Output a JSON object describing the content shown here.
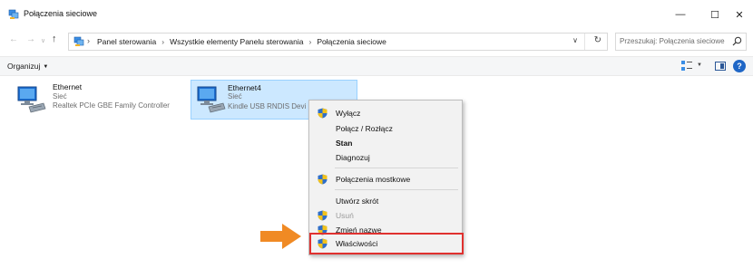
{
  "window": {
    "title": "Połączenia sieciowe",
    "controls": {
      "minimize": "—",
      "maximize": "☐",
      "close": "✕"
    }
  },
  "navigation": {
    "back": "←",
    "forward": "→",
    "history": "∨",
    "up": "↑",
    "breadcrumb": [
      "Panel sterowania",
      "Wszystkie elementy Panelu sterowania",
      "Połączenia sieciowe"
    ],
    "separator": "›",
    "dropdown": "∨",
    "refresh": "↻"
  },
  "search": {
    "placeholder": "Przeszukaj: Połączenia sieciowe"
  },
  "commandbar": {
    "organize_label": "Organizuj",
    "caret": "▼",
    "views_caret": "▼",
    "help": "?"
  },
  "connections": [
    {
      "name": "Ethernet",
      "type": "Sieć",
      "device": "Realtek PCIe GBE Family Controller",
      "selected": false
    },
    {
      "name": "Ethernet4",
      "type": "Sieć",
      "device": "Kindle USB RNDIS Devi",
      "selected": true
    }
  ],
  "context_menu": {
    "items": [
      {
        "label": "Wyłącz",
        "shield": true,
        "bold": false,
        "disabled": false
      },
      {
        "label": "Połącz / Rozłącz",
        "shield": false,
        "bold": false,
        "disabled": false
      },
      {
        "label": "Stan",
        "shield": false,
        "bold": true,
        "disabled": false
      },
      {
        "label": "Diagnozuj",
        "shield": false,
        "bold": false,
        "disabled": false
      },
      {
        "label": "Połączenia mostkowe",
        "shield": true,
        "bold": false,
        "disabled": false
      },
      {
        "label": "Utwórz skrót",
        "shield": false,
        "bold": false,
        "disabled": false
      },
      {
        "label": "Usuń",
        "shield": true,
        "bold": false,
        "disabled": true
      },
      {
        "label": "Zmień nazwę",
        "shield": true,
        "bold": false,
        "disabled": false
      },
      {
        "label": "Właściwości",
        "shield": true,
        "bold": false,
        "disabled": false,
        "highlighted": true
      }
    ]
  },
  "colors": {
    "selection_fill": "#cce8ff",
    "selection_border": "#99d1ff",
    "highlight_outline": "#e0312f",
    "arrow": "#f08a24",
    "help_blue": "#1f66c6"
  }
}
